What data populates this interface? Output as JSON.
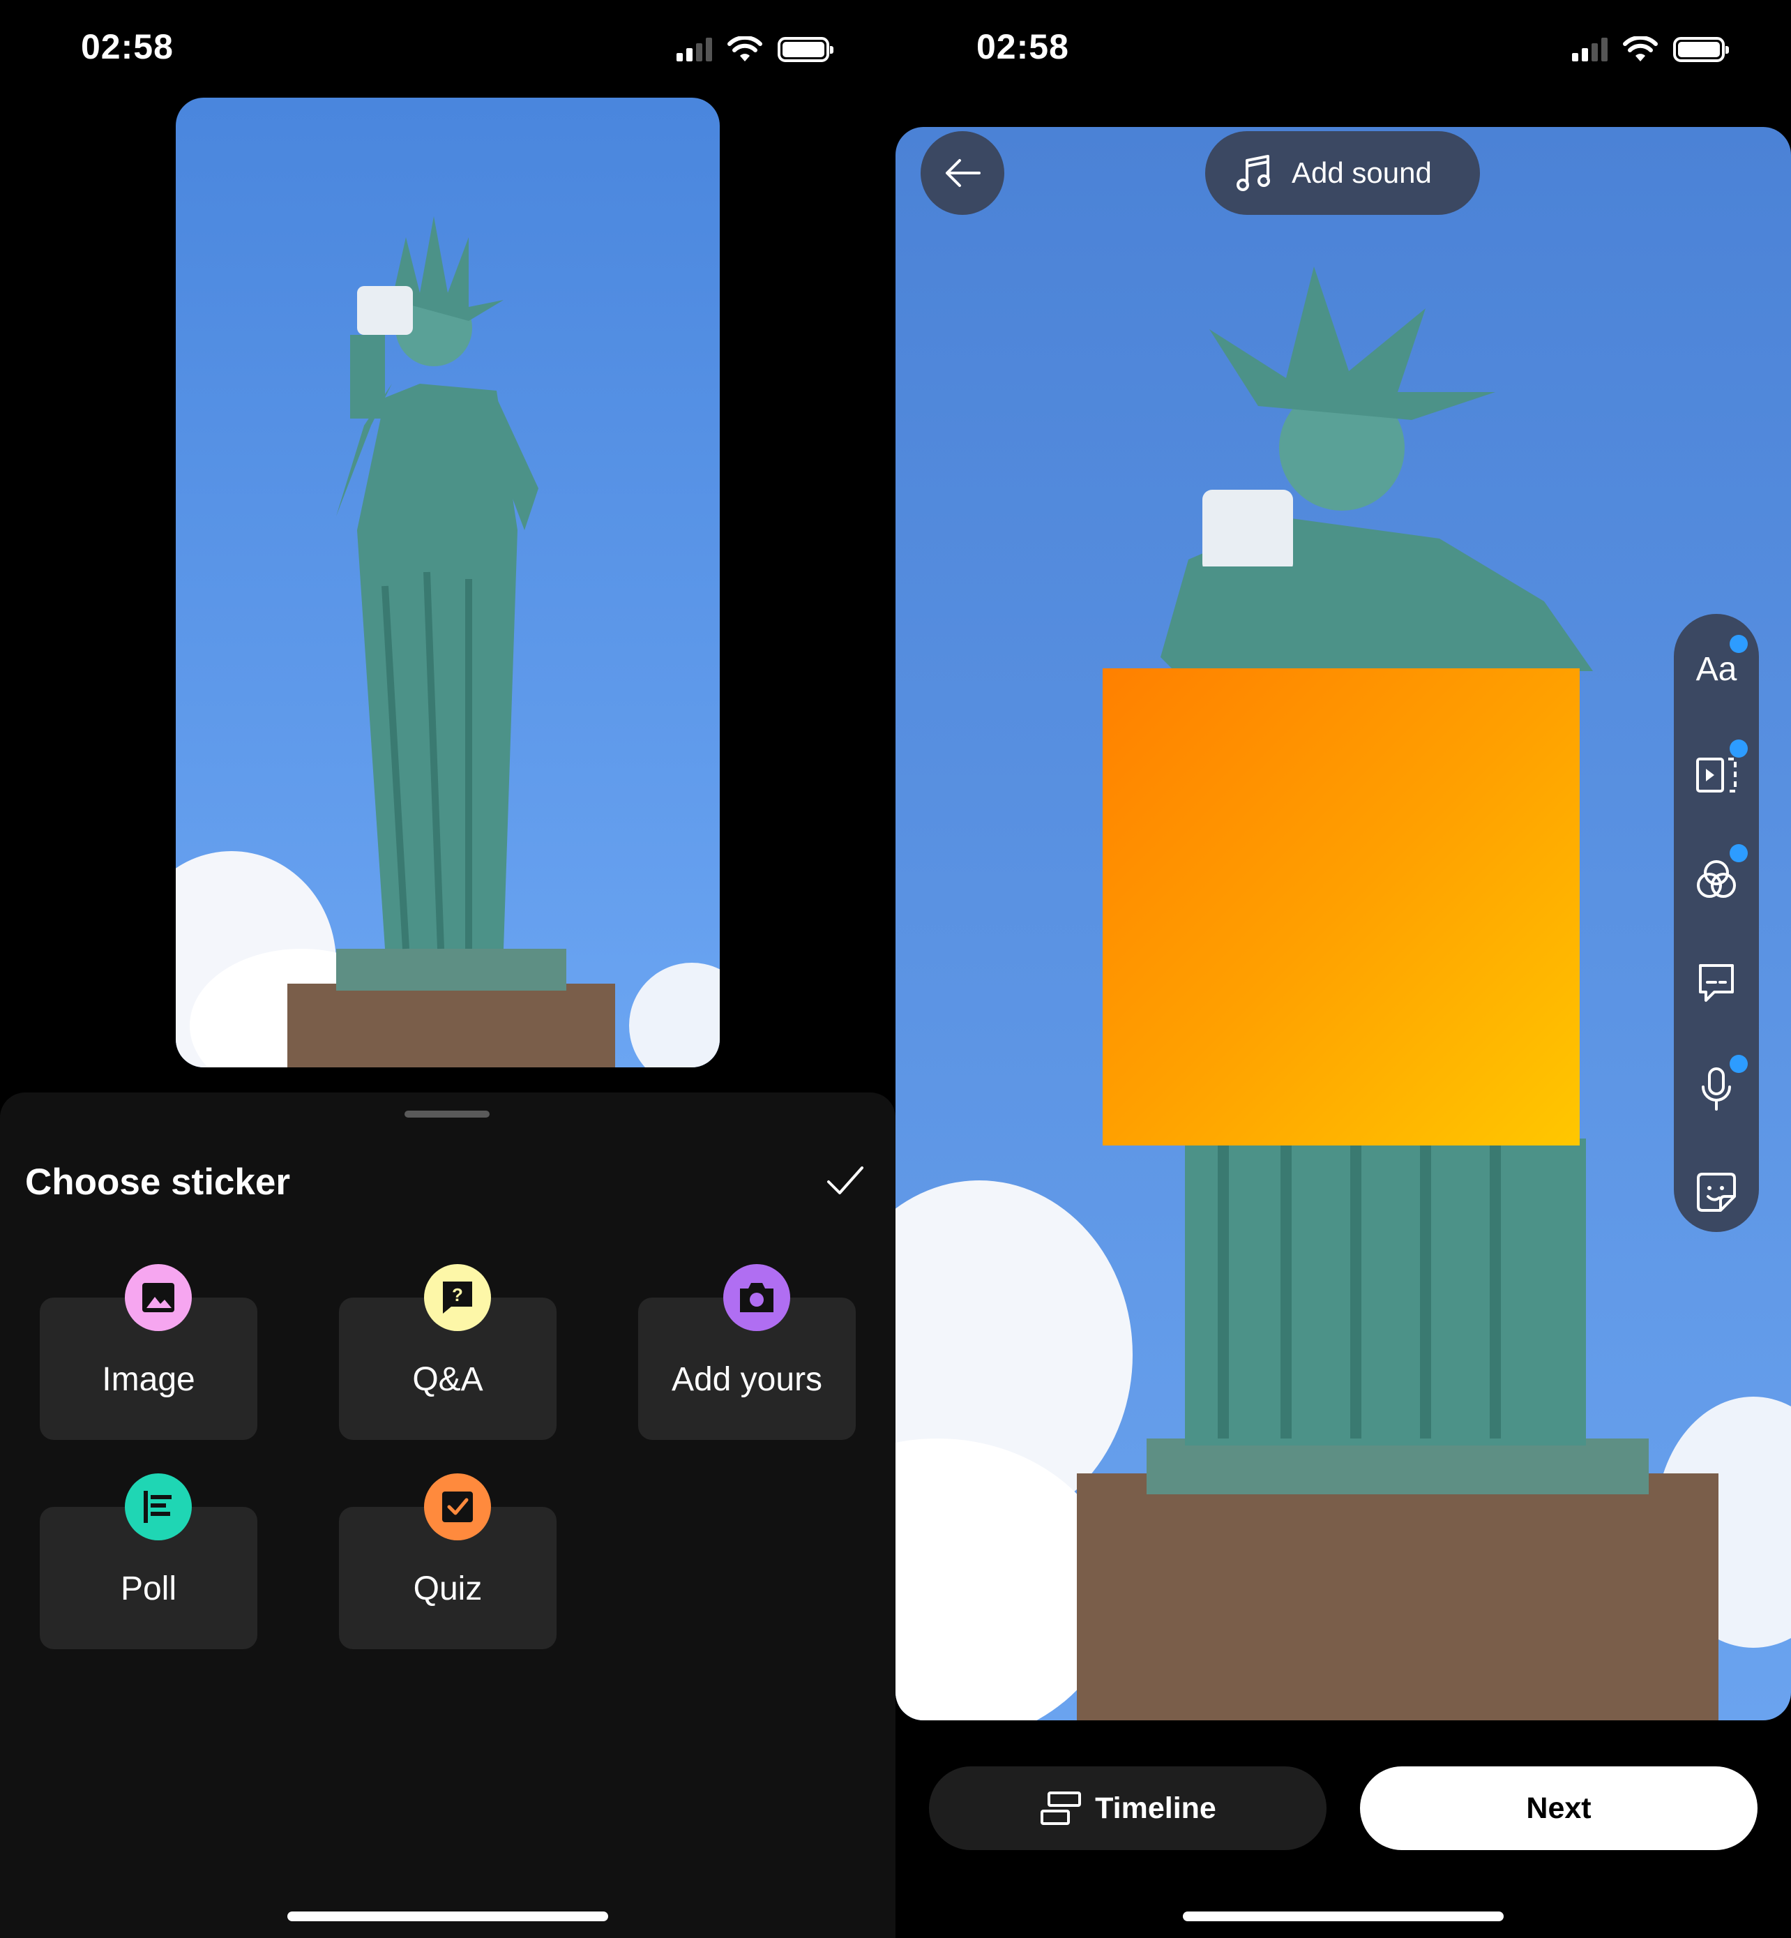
{
  "status_bar": {
    "time": "02:58"
  },
  "left": {
    "sheet": {
      "title": "Choose sticker",
      "stickers": [
        {
          "label": "Image",
          "icon": "image-icon",
          "color": "#f6a6f0"
        },
        {
          "label": "Q&A",
          "icon": "question-bubble-icon",
          "color": "#fdf7a8"
        },
        {
          "label": "Add yours",
          "icon": "camera-icon",
          "color": "#b06ef2"
        },
        {
          "label": "Poll",
          "icon": "poll-icon",
          "color": "#1fd6b4"
        },
        {
          "label": "Quiz",
          "icon": "checkbox-icon",
          "color": "#ff8a3d"
        }
      ]
    }
  },
  "right": {
    "add_sound_label": "Add sound",
    "tools": [
      {
        "label": "Aa",
        "icon": "text-icon",
        "has_dot": true
      },
      {
        "icon": "trim-clip-icon",
        "has_dot": true
      },
      {
        "icon": "filters-icon",
        "has_dot": true
      },
      {
        "icon": "captions-icon",
        "has_dot": false
      },
      {
        "icon": "microphone-icon",
        "has_dot": true
      },
      {
        "icon": "sticker-icon",
        "has_dot": false
      }
    ],
    "timeline_label": "Timeline",
    "next_label": "Next",
    "sticker_color_start": "#ff8000",
    "sticker_color_end": "#ffc700"
  },
  "colors": {
    "accent_dot": "#2d9cff",
    "control_bg": "#3b4862",
    "sheet_bg": "#111111",
    "tile_bg": "#262626"
  }
}
